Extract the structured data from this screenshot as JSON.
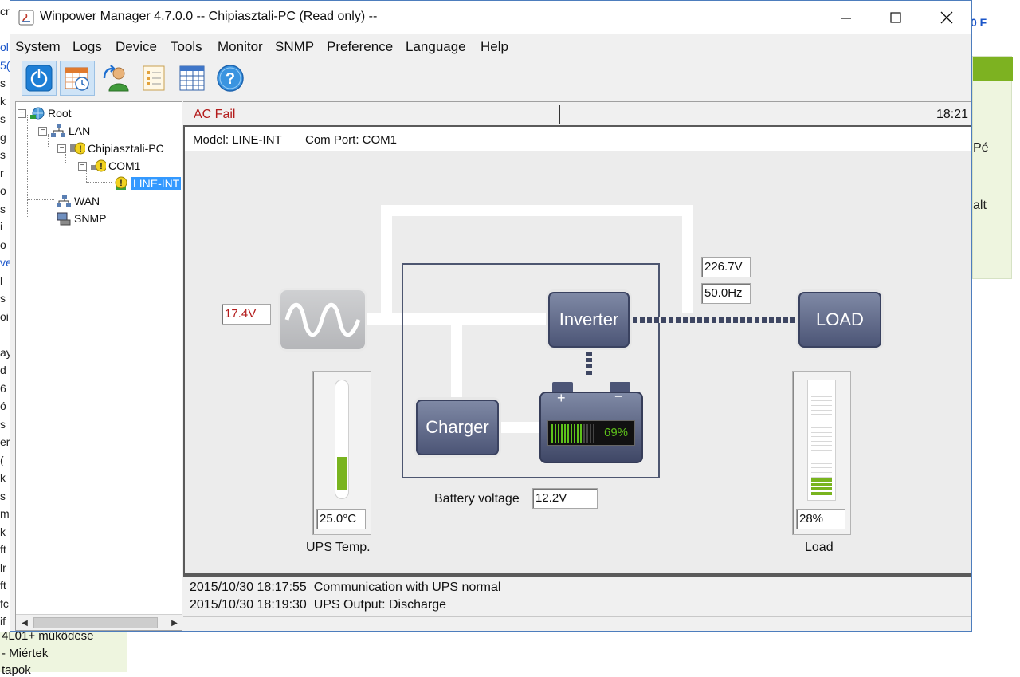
{
  "background": {
    "left_fragments": [
      "cr",
      "",
      "ol",
      "5(",
      "s",
      "k",
      "s",
      "g",
      "s",
      "r",
      "o",
      "s",
      "i",
      "o",
      "ve",
      "l",
      "s",
      "oi",
      "",
      "ay",
      "d",
      "6",
      "ó",
      "s",
      "er",
      "(",
      "k",
      "s",
      "m",
      "k",
      "ft",
      "lr",
      "ft",
      "fc",
      "if"
    ],
    "bottom_lines": [
      "4L01+ működése",
      "- Miértek",
      "tapok"
    ],
    "ad_text": "0 F",
    "right_panel_lines": [
      "Pé",
      "alt"
    ]
  },
  "window": {
    "title": "Winpower Manager 4.7.0.0 -- Chipiasztali-PC (Read only) --",
    "controls": {
      "minimize": "minimize",
      "maximize": "maximize",
      "close": "close"
    }
  },
  "menu": [
    {
      "label": "System"
    },
    {
      "label": "Logs"
    },
    {
      "label": "Device"
    },
    {
      "label": "Tools"
    },
    {
      "label": "Monitor"
    },
    {
      "label": "SNMP"
    },
    {
      "label": "Preference"
    },
    {
      "label": "Language"
    },
    {
      "label": "Help"
    }
  ],
  "toolbar": [
    {
      "icon": "power-icon"
    },
    {
      "icon": "schedule-calendar-icon"
    },
    {
      "icon": "user-agent-icon"
    },
    {
      "icon": "checklist-icon"
    },
    {
      "icon": "spreadsheet-icon"
    },
    {
      "icon": "help-icon"
    }
  ],
  "tree": {
    "root": "Root",
    "lan": "LAN",
    "host": "Chipiasztali-PC",
    "port": "COM1",
    "device": "LINE-INT",
    "wan": "WAN",
    "snmp": "SNMP"
  },
  "status": {
    "alarm": "AC Fail",
    "time": "18:21"
  },
  "model_bar": {
    "model": "Model: LINE-INT",
    "port": "Com Port: COM1"
  },
  "diagram": {
    "input_voltage": "17.4V",
    "output_voltage": "226.7V",
    "output_frequency": "50.0Hz",
    "inverter_label": "Inverter",
    "charger_label": "Charger",
    "load_label": "LOAD",
    "battery_percent": "69%",
    "battery_plus": "+",
    "battery_minus": "−",
    "battery_voltage_label": "Battery voltage",
    "battery_voltage": "12.2V",
    "temperature": "25.0°C",
    "temperature_label": "UPS Temp.",
    "temperature_fraction": 0.3,
    "load_percent": "28%",
    "load_label_caption": "Load",
    "load_fraction": 0.28,
    "battery_fraction": 0.69,
    "colors": {
      "alarm": "#b31b1b",
      "gauge_green": "#79b41f",
      "battery_green": "#5ec21a"
    }
  },
  "log": [
    {
      "timestamp": "2015/10/30 18:17:55",
      "message": "Communication with UPS normal"
    },
    {
      "timestamp": "2015/10/30 18:19:30",
      "message": "UPS Output: Discharge"
    }
  ]
}
